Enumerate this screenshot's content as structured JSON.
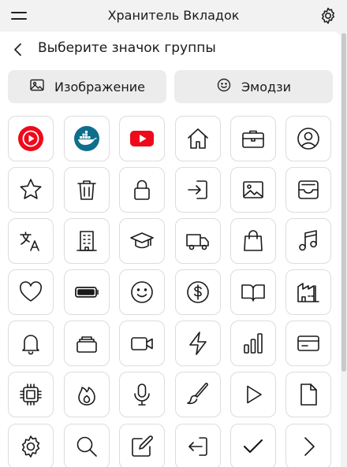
{
  "header": {
    "title": "Хранитель Вкладок"
  },
  "page": {
    "title": "Выберите значок группы"
  },
  "tabs": [
    {
      "label": "Изображение",
      "icon": "image-icon"
    },
    {
      "label": "Эмодзи",
      "icon": "smiley-icon"
    }
  ],
  "icons": [
    [
      "youtube-music-icon",
      "docker-icon",
      "youtube-icon",
      "home-icon",
      "briefcase-icon",
      "user-circle-icon"
    ],
    [
      "star-icon",
      "trash-icon",
      "lock-icon",
      "login-icon",
      "image-icon",
      "archive-tray-icon"
    ],
    [
      "translate-icon",
      "building-icon",
      "graduation-cap-icon",
      "truck-icon",
      "shopping-bag-icon",
      "music-note-icon"
    ],
    [
      "heart-icon",
      "battery-icon",
      "smiley-icon",
      "dollar-icon",
      "book-open-icon",
      "factory-icon"
    ],
    [
      "bell-icon",
      "stack-icon",
      "video-camera-icon",
      "lightning-icon",
      "bar-chart-icon",
      "credit-card-icon"
    ],
    [
      "cpu-icon",
      "fire-icon",
      "microphone-icon",
      "paintbrush-icon",
      "play-icon",
      "file-icon"
    ],
    [
      "gear-icon",
      "search-icon",
      "edit-icon",
      "logout-icon",
      "check-icon",
      "chevron-right-icon"
    ]
  ],
  "colors": {
    "brand_red": "#ee0a1b",
    "docker_blue": "#0f6e8c",
    "icon_stroke": "#1a1a1a"
  }
}
